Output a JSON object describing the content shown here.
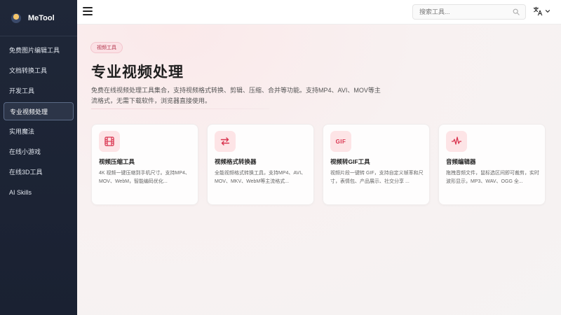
{
  "brand": {
    "name": "MeTool"
  },
  "sidebar": {
    "items": [
      {
        "label": "免费图片编辑工具"
      },
      {
        "label": "文档转换工具"
      },
      {
        "label": "开发工具"
      },
      {
        "label": "专业视频处理",
        "active": true
      },
      {
        "label": "实用魔法"
      },
      {
        "label": "在线小游戏"
      },
      {
        "label": "在线3D工具"
      },
      {
        "label": "AI Skills"
      }
    ]
  },
  "topbar": {
    "search_placeholder": "搜索工具...",
    "language_icon": "translate-icon"
  },
  "main": {
    "tag": "视频工具",
    "title": "专业视频处理",
    "description": "免费在线视频处理工具集合，支持视频格式转换、剪辑、压缩、合并等功能。支持MP4、AVI、MOV等主流格式，无需下载软件，浏览器直接使用。",
    "cards": [
      {
        "icon": "film-icon",
        "title": "视频压缩工具",
        "desc": "4K 视频一键压缩到手机尺寸。支持MP4、MOV、WebM，智能编码优化..."
      },
      {
        "icon": "swap-arrows-icon",
        "title": "视频格式转换器",
        "desc": "全能视频格式转换工具，支持MP4、AVI、MOV、MKV、WebM等主流格式..."
      },
      {
        "icon": "gif-icon",
        "icon_text": "GIF",
        "title": "视频转GIF工具",
        "desc": "视频片段一键转 GIF，支持自定义帧率和尺寸，表情包、产品展示、社交分享 ..."
      },
      {
        "icon": "audio-wave-icon",
        "title": "音频编辑器",
        "desc": "拖拽音频文件，鼠标选区间即可裁剪，实时波形显示，MP3、WAV、OGG 全..."
      }
    ]
  },
  "colors": {
    "sidebar_bg": "#1f2738",
    "accent": "#d9344f",
    "icon_bg": "#fde4e6"
  }
}
